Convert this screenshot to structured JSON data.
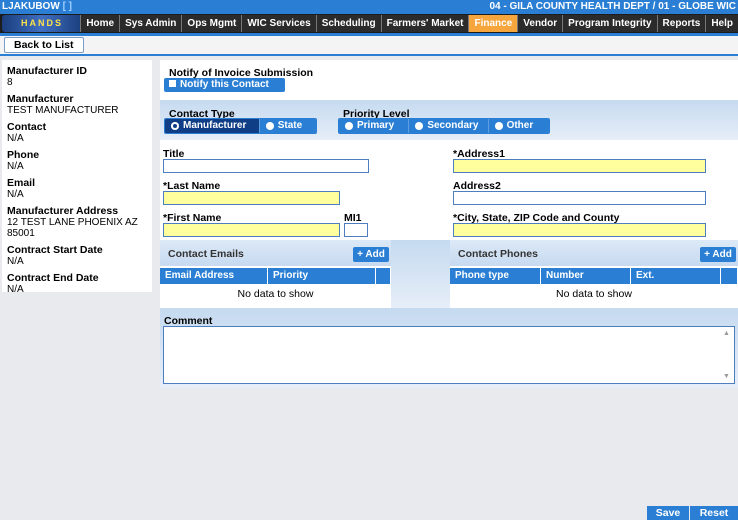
{
  "header": {
    "user": "LJAKUBOW",
    "user_link": "[ ]",
    "clinic": "04 - GILA COUNTY HEALTH DEPT / 01 - GLOBE WIC",
    "logo_text": "HANDS"
  },
  "menu": [
    {
      "label": "Home"
    },
    {
      "label": "Sys Admin"
    },
    {
      "label": "Ops Mgmt"
    },
    {
      "label": "WIC Services"
    },
    {
      "label": "Scheduling"
    },
    {
      "label": "Farmers' Market"
    },
    {
      "label": "Finance"
    },
    {
      "label": "Vendor"
    },
    {
      "label": "Program Integrity"
    },
    {
      "label": "Reports"
    },
    {
      "label": "Help"
    }
  ],
  "toolbar": {
    "back_label": "Back to List"
  },
  "details": [
    {
      "label": "Manufacturer ID",
      "value": "8"
    },
    {
      "label": "Manufacturer",
      "value": "TEST MANUFACTURER"
    },
    {
      "label": "Contact",
      "value": "N/A"
    },
    {
      "label": "Phone",
      "value": "N/A"
    },
    {
      "label": "Email",
      "value": "N/A"
    },
    {
      "label": "Manufacturer Address",
      "value": "12 TEST LANE PHOENIX AZ 85001"
    },
    {
      "label": "Contract Start Date",
      "value": "N/A"
    },
    {
      "label": "Contract End Date",
      "value": "N/A"
    }
  ],
  "notify": {
    "title": "Notify of Invoice Submission",
    "button": "Notify this Contact"
  },
  "contact_type": {
    "label": "Contact Type",
    "options": [
      "Manufacturer",
      "State"
    ],
    "selected": "Manufacturer"
  },
  "priority": {
    "label": "Priority Level",
    "options": [
      "Primary",
      "Secondary",
      "Other"
    ]
  },
  "form": {
    "title": "Title",
    "last_name": "*Last Name",
    "first_name": "*First Name",
    "mi": "MI1",
    "address1": "*Address1",
    "address2": "Address2",
    "city": "*City, State, ZIP Code and County"
  },
  "emails": {
    "title": "Contact Emails",
    "add": "Add",
    "columns": [
      "Email Address",
      "Priority"
    ],
    "empty": "No data to show"
  },
  "phones": {
    "title": "Contact Phones",
    "add": "Add",
    "columns": [
      "Phone type",
      "Number",
      "Ext."
    ],
    "empty": "No data to show"
  },
  "comment": {
    "label": "Comment"
  },
  "footer": {
    "save": "Save",
    "reset": "Reset"
  }
}
